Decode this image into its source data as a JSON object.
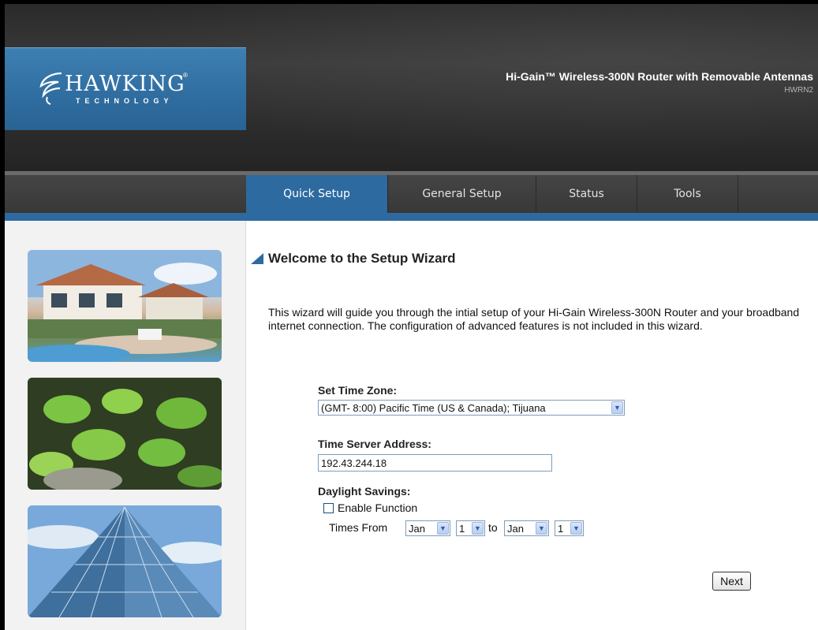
{
  "header": {
    "logo_word": "HAWKING",
    "logo_reg": "®",
    "logo_tech": "TECHNOLOGY",
    "product_title": "Hi-Gain™ Wireless-300N Router with Removable Antennas",
    "product_model": "HWRN2"
  },
  "nav": {
    "tabs": [
      {
        "label": "Quick Setup",
        "active": true
      },
      {
        "label": "General Setup",
        "active": false
      },
      {
        "label": "Status",
        "active": false
      },
      {
        "label": "Tools",
        "active": false
      }
    ]
  },
  "main": {
    "title": "Welcome to the Setup Wizard",
    "intro": "This wizard will guide you through the intial setup of your Hi-Gain Wireless-300N Router and your broadband internet connection. The configuration of advanced features is not included in this wizard.",
    "time_zone": {
      "label": "Set Time Zone:",
      "value": "(GMT- 8:00) Pacific Time (US & Canada); Tijuana"
    },
    "time_server": {
      "label": "Time Server Address:",
      "value": "192.43.244.18"
    },
    "daylight": {
      "label": "Daylight Savings:",
      "enable_label": "Enable Function",
      "enabled": false,
      "times_from_label": "Times From",
      "to_label": "to",
      "from_month": "Jan",
      "from_day": "1",
      "to_month": "Jan",
      "to_day": "1"
    },
    "next_label": "Next"
  },
  "colors": {
    "accent_blue": "#2d6aa0",
    "header_dark": "#2d2d2d"
  },
  "icons": {
    "select_arrow": "chevron-down-icon",
    "title_marker": "triangle-icon"
  }
}
